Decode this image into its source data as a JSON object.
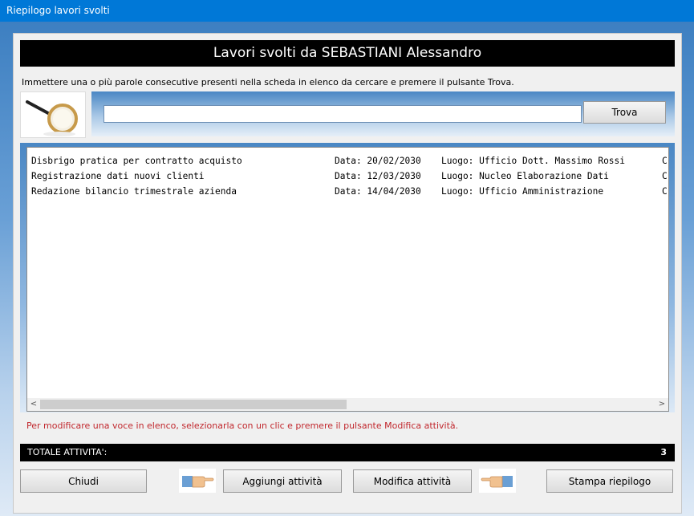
{
  "window": {
    "title": "Riepilogo lavori svolti"
  },
  "header": {
    "title": "Lavori svolti da SEBASTIANI Alessandro"
  },
  "search": {
    "instruction": "Immettere una o più parole consecutive presenti nella scheda in elenco da cercare e premere il pulsante Trova.",
    "value": "",
    "button": "Trova"
  },
  "list": {
    "rows": [
      {
        "desc": "Disbrigo pratica per contratto acquisto",
        "data": "Data: 20/02/2030",
        "luogo": "Luogo: Ufficio Dott. Massimo Rossi",
        "extra": "C"
      },
      {
        "desc": "Registrazione dati nuovi clienti",
        "data": "Data: 12/03/2030",
        "luogo": "Luogo: Nucleo Elaborazione Dati",
        "extra": "C"
      },
      {
        "desc": "Redazione bilancio trimestrale azienda",
        "data": "Data: 14/04/2030",
        "luogo": "Luogo: Ufficio Amministrazione",
        "extra": "C"
      }
    ],
    "scroll_left": "<",
    "scroll_right": ">"
  },
  "note": "Per modificare una voce in elenco, selezionarla con un clic e premere il pulsante Modifica attività.",
  "total": {
    "label": "TOTALE ATTIVITA':",
    "value": "3"
  },
  "buttons": {
    "close": "Chiudi",
    "add": "Aggiungi attività",
    "edit": "Modifica attività",
    "print": "Stampa riepilogo"
  },
  "icons": {
    "search": "magnifier-icon",
    "hand_left": "pointing-hand-icon",
    "hand_right": "pointing-hand-icon"
  },
  "colors": {
    "titlebar": "#0078d7",
    "note": "#c1272d"
  }
}
